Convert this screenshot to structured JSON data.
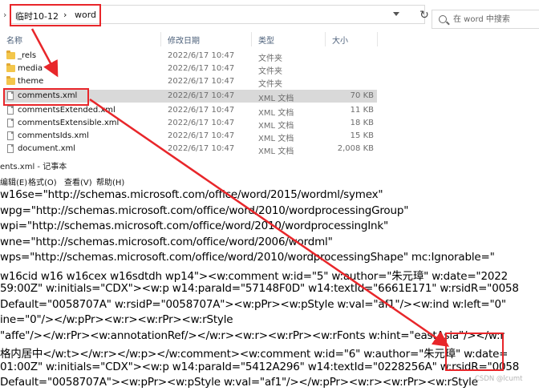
{
  "explorer": {
    "breadcrumbs": [
      "临时10-12",
      "word"
    ],
    "breadcrumb_separator": "›",
    "refresh_icon": "refresh-icon",
    "search_placeholder": "在 word 中搜索",
    "columns": {
      "name": "名称",
      "date": "修改日期",
      "type": "类型",
      "size": "大小"
    },
    "files": [
      {
        "name": "_rels",
        "date": "2022/6/17 10:47",
        "type": "文件夹",
        "size": "",
        "icon": "folder-icon"
      },
      {
        "name": "media",
        "date": "2022/6/17 10:47",
        "type": "文件夹",
        "size": "",
        "icon": "folder-icon"
      },
      {
        "name": "theme",
        "date": "2022/6/17 10:47",
        "type": "文件夹",
        "size": "",
        "icon": "folder-icon"
      },
      {
        "name": "comments.xml",
        "date": "2022/6/17 10:47",
        "type": "XML 文档",
        "size": "70 KB",
        "icon": "xml-file-icon",
        "selected": true
      },
      {
        "name": "commentsExtended.xml",
        "date": "2022/6/17 10:47",
        "type": "XML 文档",
        "size": "11 KB",
        "icon": "xml-file-icon"
      },
      {
        "name": "commentsExtensible.xml",
        "date": "2022/6/17 10:47",
        "type": "XML 文档",
        "size": "18 KB",
        "icon": "xml-file-icon"
      },
      {
        "name": "commentsIds.xml",
        "date": "2022/6/17 10:47",
        "type": "XML 文档",
        "size": "15 KB",
        "icon": "xml-file-icon"
      },
      {
        "name": "document.xml",
        "date": "2022/6/17 10:47",
        "type": "XML 文档",
        "size": "2,008 KB",
        "icon": "xml-file-icon"
      }
    ]
  },
  "notepad": {
    "title": "ents.xml - 记事本",
    "menu": {
      "edit": "编辑(E)",
      "format": "格式(O)",
      "view": "查看(V)",
      "help": "帮助(H)"
    },
    "lines": [
      "w16se=\"http://schemas.microsoft.com/office/word/2015/wordml/symex\"",
      "wpg=\"http://schemas.microsoft.com/office/word/2010/wordprocessingGroup\"",
      "wpi=\"http://schemas.microsoft.com/office/word/2010/wordprocessingInk\"",
      "wne=\"http://schemas.microsoft.com/office/word/2006/wordml\"",
      "wps=\"http://schemas.microsoft.com/office/word/2010/wordprocessingShape\" mc:Ignorable=\"",
      "w16cid w16 w16cex w16sdtdh wp14\"><w:comment w:id=\"5\" w:author=\"朱元璋\" w:date=\"2022",
      "59:00Z\" w:initials=\"CDX\"><w:p w14:paraId=\"57148F0D\" w14:textId=\"6661E171\" w:rsidR=\"0058",
      "Default=\"0058707A\" w:rsidP=\"0058707A\"><w:pPr><w:pStyle w:val=\"af1\"/><w:ind w:left=\"0\"",
      "ine=\"0\"/></w:pPr><w:r><w:rPr><w:rStyle",
      "\"affe\"/></w:rPr><w:annotationRef/></w:r><w:r><w:rPr><w:rFonts w:hint=\"eastAsia\"/></w:r",
      "格内居中</w:t></w:r></w:p></w:comment><w:comment w:id=\"6\" w:author=\"朱元璋\" w:date=",
      "01:00Z\" w:initials=\"CDX\"><w:p w14:paraId=\"5412A296\" w14:textId=\"0228256A\" w:rsidR=\"0058",
      "Default=\"0058707A\"><w:pPr><w:pStyle w:val=\"af1\"/></w:pPr><w:r><w:rPr><w:rStyle"
    ],
    "watermark": "CSDN @lcumt"
  },
  "annotation_color": "#e8262a"
}
